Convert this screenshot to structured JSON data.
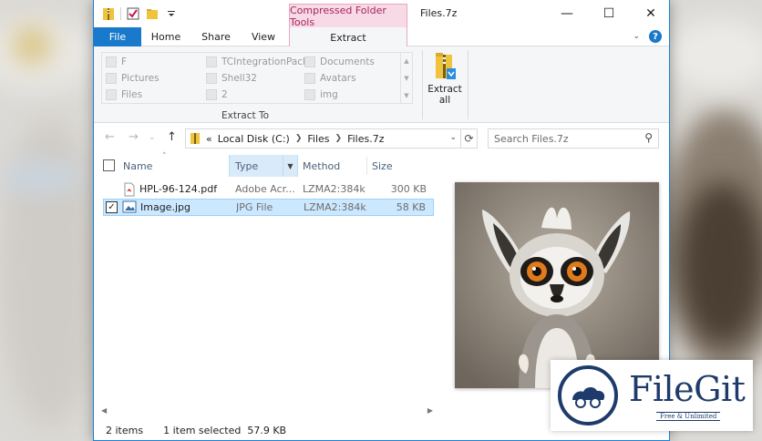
{
  "window": {
    "context_tab": "Compressed Folder Tools",
    "title": "Files.7z",
    "controls": {
      "minimize": "—",
      "maximize": "☐",
      "close": "✕"
    }
  },
  "ribbon_tabs": [
    "File",
    "Home",
    "Share",
    "View",
    "Extract"
  ],
  "extract_to": {
    "items": [
      "F",
      "TCIntegrationPack",
      "Documents",
      "Pictures",
      "Shell32",
      "Avatars",
      "Files",
      "2",
      "img"
    ],
    "group_label": "Extract To"
  },
  "extract_all": {
    "line1": "Extract",
    "line2": "all"
  },
  "address": {
    "overflow": "«",
    "breadcrumbs": [
      "Local Disk (C:)",
      "Files",
      "Files.7z"
    ]
  },
  "search": {
    "placeholder": "Search Files.7z"
  },
  "columns": {
    "name": "Name",
    "type": "Type",
    "method": "Method",
    "size": "Size"
  },
  "files": [
    {
      "name": "HPL-96-124.pdf",
      "type": "Adobe Acr...",
      "method": "LZMA2:384k",
      "size": "300 KB",
      "selected": false
    },
    {
      "name": "Image.jpg",
      "type": "JPG File",
      "method": "LZMA2:384k",
      "size": "58 KB",
      "selected": true
    }
  ],
  "status": {
    "items": "2 items",
    "selection": "1 item selected",
    "sel_size": "57.9 KB"
  },
  "watermark": {
    "brand": "FileGit",
    "tagline": "Free & Unlimited"
  },
  "colors": {
    "accent": "#1979ca",
    "context": "#f8d9e6",
    "selection": "#cce8ff"
  },
  "icons": [
    "folder-icon",
    "checkbox-icon",
    "pdf-icon",
    "image-icon",
    "zip-folder-icon",
    "search-icon",
    "refresh-icon",
    "help-icon",
    "up-arrow-icon",
    "back-arrow-icon",
    "forward-arrow-icon"
  ]
}
